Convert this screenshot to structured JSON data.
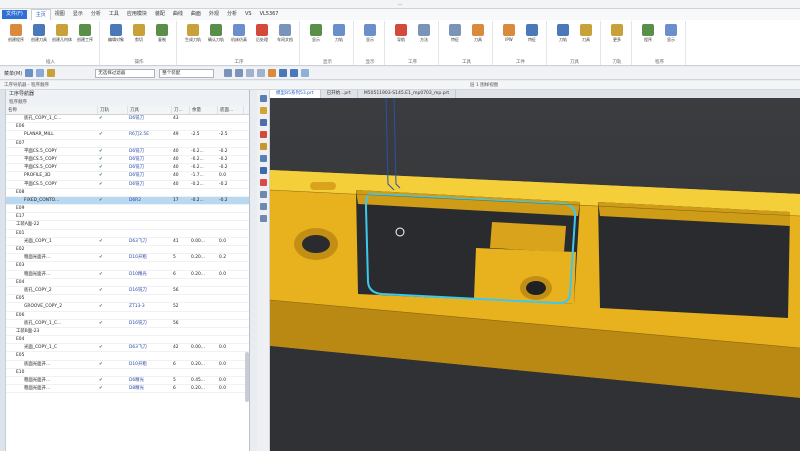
{
  "window": {
    "title": "…"
  },
  "menu": {
    "app_button": "文件(F)",
    "items": [
      "主页",
      "视图",
      "显示",
      "分析",
      "工具",
      "应用模块",
      "装配",
      "曲线",
      "曲面",
      "外观",
      "分析",
      "VS",
      "VL5367"
    ],
    "active_index": 0
  },
  "ribbon": {
    "groups": [
      {
        "label": "插入",
        "buttons": [
          "创建程序",
          "创建刀具",
          "创建几何体",
          "创建工序"
        ]
      },
      {
        "label": "操作",
        "buttons": [
          "编辑对象",
          "剪切",
          "复制"
        ]
      },
      {
        "label": "工序",
        "buttons": [
          "生成刀轨",
          "确认刀轨",
          "机床仿真",
          "后处理",
          "车间文档"
        ]
      },
      {
        "label": "显示",
        "buttons": [
          "显示",
          "刀轨"
        ]
      },
      {
        "label": "显示",
        "buttons": [
          "显示"
        ]
      },
      {
        "label": "工序",
        "buttons": [
          "导航",
          "方法"
        ]
      },
      {
        "label": "工具",
        "buttons": [
          "特征",
          "刀具"
        ]
      },
      {
        "label": "工件",
        "buttons": [
          "IPW",
          "特征"
        ]
      },
      {
        "label": "刀具",
        "buttons": [
          "刀轨",
          "刀具"
        ]
      },
      {
        "label": "刀轨",
        "buttons": [
          "更多"
        ]
      },
      {
        "label": "程序",
        "buttons": [
          "程序",
          "显示"
        ]
      }
    ]
  },
  "toolbar": {
    "menu_label": "菜单(M)",
    "filter_select": "无选择过滤器",
    "assembly_select": "整个装配"
  },
  "breadcrumb": {
    "left": "工序导航器 - 程序顺序",
    "right": "层 1 图样视图"
  },
  "nav": {
    "title": "工序导航器",
    "subtitle": "程序顺序",
    "columns": [
      "名称",
      "刀轨",
      "刀具",
      "刀...",
      "余量",
      "底面..."
    ],
    "rows": [
      {
        "name": "底孔_COPY_1_C...",
        "path": "✔",
        "tool": "D6铣刀",
        "num": "43",
        "stock": "",
        "floor": ""
      },
      {
        "name": "E06",
        "path": "",
        "tool": "",
        "num": "",
        "stock": "",
        "floor": ""
      },
      {
        "name": "PLANAR_MILL",
        "path": "✔",
        "tool": "R6刀2.5E",
        "num": "49",
        "stock": "-2.5",
        "floor": "-2.5"
      },
      {
        "name": "E07",
        "path": "",
        "tool": "",
        "num": "",
        "stock": "",
        "floor": ""
      },
      {
        "name": "平面CS.5_COPY",
        "path": "✔",
        "tool": "D6铣刀",
        "num": "40",
        "stock": "-0.2...",
        "floor": "-0.2"
      },
      {
        "name": "平面CS.5_COPY",
        "path": "✔",
        "tool": "D6铣刀",
        "num": "40",
        "stock": "-0.2...",
        "floor": "-0.2"
      },
      {
        "name": "平面CS.5_COPY",
        "path": "✔",
        "tool": "D6铣刀",
        "num": "40",
        "stock": "-0.2...",
        "floor": "-0.2"
      },
      {
        "name": "PROFILE_3D",
        "path": "✔",
        "tool": "D6铣刀",
        "num": "40",
        "stock": "-1.7...",
        "floor": "0.0"
      },
      {
        "name": "平面CS.5_COPY",
        "path": "✔",
        "tool": "D6铣刀",
        "num": "40",
        "stock": "-0.2...",
        "floor": "-0.2"
      },
      {
        "name": "E08",
        "path": "",
        "tool": "",
        "num": "",
        "stock": "",
        "floor": ""
      },
      {
        "name": "FIXED_CONTO...",
        "path": "✔",
        "tool": "D6R2",
        "num": "17",
        "stock": "-0.2...",
        "floor": "-0.2",
        "selected": true
      },
      {
        "name": "E09",
        "path": "",
        "tool": "",
        "num": "",
        "stock": "",
        "floor": ""
      },
      {
        "name": "E17",
        "path": "",
        "tool": "",
        "num": "",
        "stock": "",
        "floor": ""
      },
      {
        "name": "工装A面-22",
        "path": "",
        "tool": "",
        "num": "",
        "stock": "",
        "floor": ""
      },
      {
        "name": "E01",
        "path": "",
        "tool": "",
        "num": "",
        "stock": "",
        "floor": ""
      },
      {
        "name": "光面_COPY_1",
        "path": "✔",
        "tool": "D63飞刀",
        "num": "41",
        "stock": "0.00...",
        "floor": "0.0"
      },
      {
        "name": "E02",
        "path": "",
        "tool": "",
        "num": "",
        "stock": "",
        "floor": ""
      },
      {
        "name": "粗面光面开...",
        "path": "✔",
        "tool": "D10开粗",
        "num": "5",
        "stock": "0.20...",
        "floor": "0.2"
      },
      {
        "name": "E03",
        "path": "",
        "tool": "",
        "num": "",
        "stock": "",
        "floor": ""
      },
      {
        "name": "粗面光面开...",
        "path": "✔",
        "tool": "D10精光",
        "num": "6",
        "stock": "0.20...",
        "floor": "0.0"
      },
      {
        "name": "E04",
        "path": "",
        "tool": "",
        "num": "",
        "stock": "",
        "floor": ""
      },
      {
        "name": "底孔_COPY_2",
        "path": "✔",
        "tool": "D16铣刀",
        "num": "56",
        "stock": "",
        "floor": ""
      },
      {
        "name": "E05",
        "path": "",
        "tool": "",
        "num": "",
        "stock": "",
        "floor": ""
      },
      {
        "name": "GROOVE_COPY_2",
        "path": "✔",
        "tool": "ZT13-3",
        "num": "52",
        "stock": "",
        "floor": ""
      },
      {
        "name": "E06",
        "path": "",
        "tool": "",
        "num": "",
        "stock": "",
        "floor": ""
      },
      {
        "name": "底孔_COPY_1_C...",
        "path": "✔",
        "tool": "D16铣刀",
        "num": "56",
        "stock": "",
        "floor": ""
      },
      {
        "name": "工装B面-23",
        "path": "",
        "tool": "",
        "num": "",
        "stock": "",
        "floor": ""
      },
      {
        "name": "E04",
        "path": "",
        "tool": "",
        "num": "",
        "stock": "",
        "floor": ""
      },
      {
        "name": "光面_COPY_1_C",
        "path": "✔",
        "tool": "D63飞刀",
        "num": "42",
        "stock": "0.00...",
        "floor": "0.0"
      },
      {
        "name": "E05",
        "path": "",
        "tool": "",
        "num": "",
        "stock": "",
        "floor": ""
      },
      {
        "name": "底面光面开...",
        "path": "✔",
        "tool": "D10开粗",
        "num": "6",
        "stock": "0.20...",
        "floor": "0.0"
      },
      {
        "name": "E10",
        "path": "",
        "tool": "",
        "num": "",
        "stock": "",
        "floor": ""
      },
      {
        "name": "粗面光面开...",
        "path": "✔",
        "tool": "D6精光",
        "num": "5",
        "stock": "0.45...",
        "floor": "0.0"
      },
      {
        "name": "粗面光面开...",
        "path": "✔",
        "tool": "D8精光",
        "num": "6",
        "stock": "0.20...",
        "floor": "0.0"
      }
    ]
  },
  "tabs": [
    "模型B5系列53.prt",
    "已开始...prt",
    "M50511903-S145.E1_mp0703_mp.prt"
  ],
  "colors": {
    "part": "#f2c21e",
    "toolpath": "#3fc8ee",
    "background": "#34363a",
    "accent": "#2f6fd6"
  }
}
